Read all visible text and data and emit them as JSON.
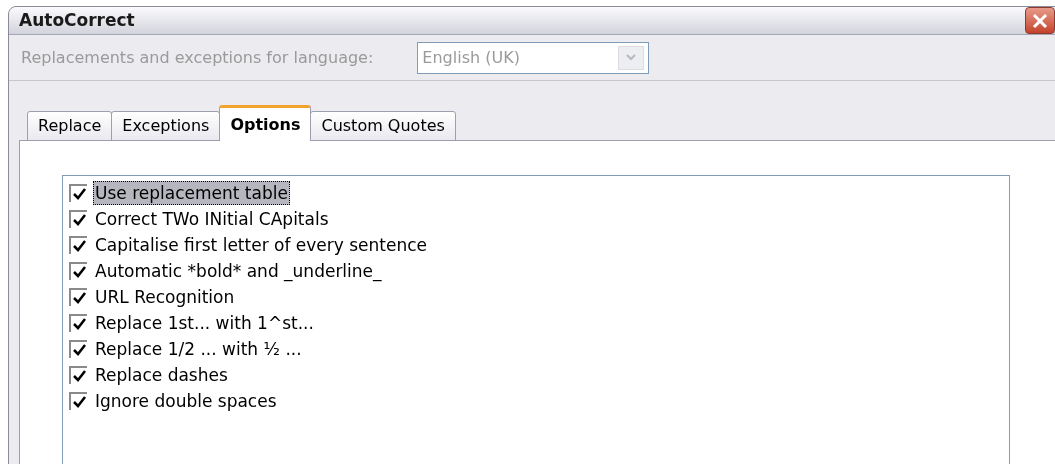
{
  "window": {
    "title": "AutoCorrect"
  },
  "language": {
    "label": "Replacements and exceptions for language:",
    "value": "English (UK)",
    "disabled": true
  },
  "tabs": [
    {
      "label": "Replace",
      "selected": false
    },
    {
      "label": "Exceptions",
      "selected": false
    },
    {
      "label": "Options",
      "selected": true
    },
    {
      "label": "Custom Quotes",
      "selected": false
    }
  ],
  "options": [
    {
      "label": "Use replacement table",
      "checked": true,
      "selected": true
    },
    {
      "label": "Correct TWo INitial CApitals",
      "checked": true,
      "selected": false
    },
    {
      "label": "Capitalise first letter of every sentence",
      "checked": true,
      "selected": false
    },
    {
      "label": "Automatic *bold* and _underline_",
      "checked": true,
      "selected": false
    },
    {
      "label": "URL Recognition",
      "checked": true,
      "selected": false
    },
    {
      "label": "Replace 1st... with 1^st...",
      "checked": true,
      "selected": false
    },
    {
      "label": "Replace 1/2 ... with ½ ...",
      "checked": true,
      "selected": false
    },
    {
      "label": "Replace dashes",
      "checked": true,
      "selected": false
    },
    {
      "label": "Ignore double spaces",
      "checked": true,
      "selected": false
    }
  ]
}
